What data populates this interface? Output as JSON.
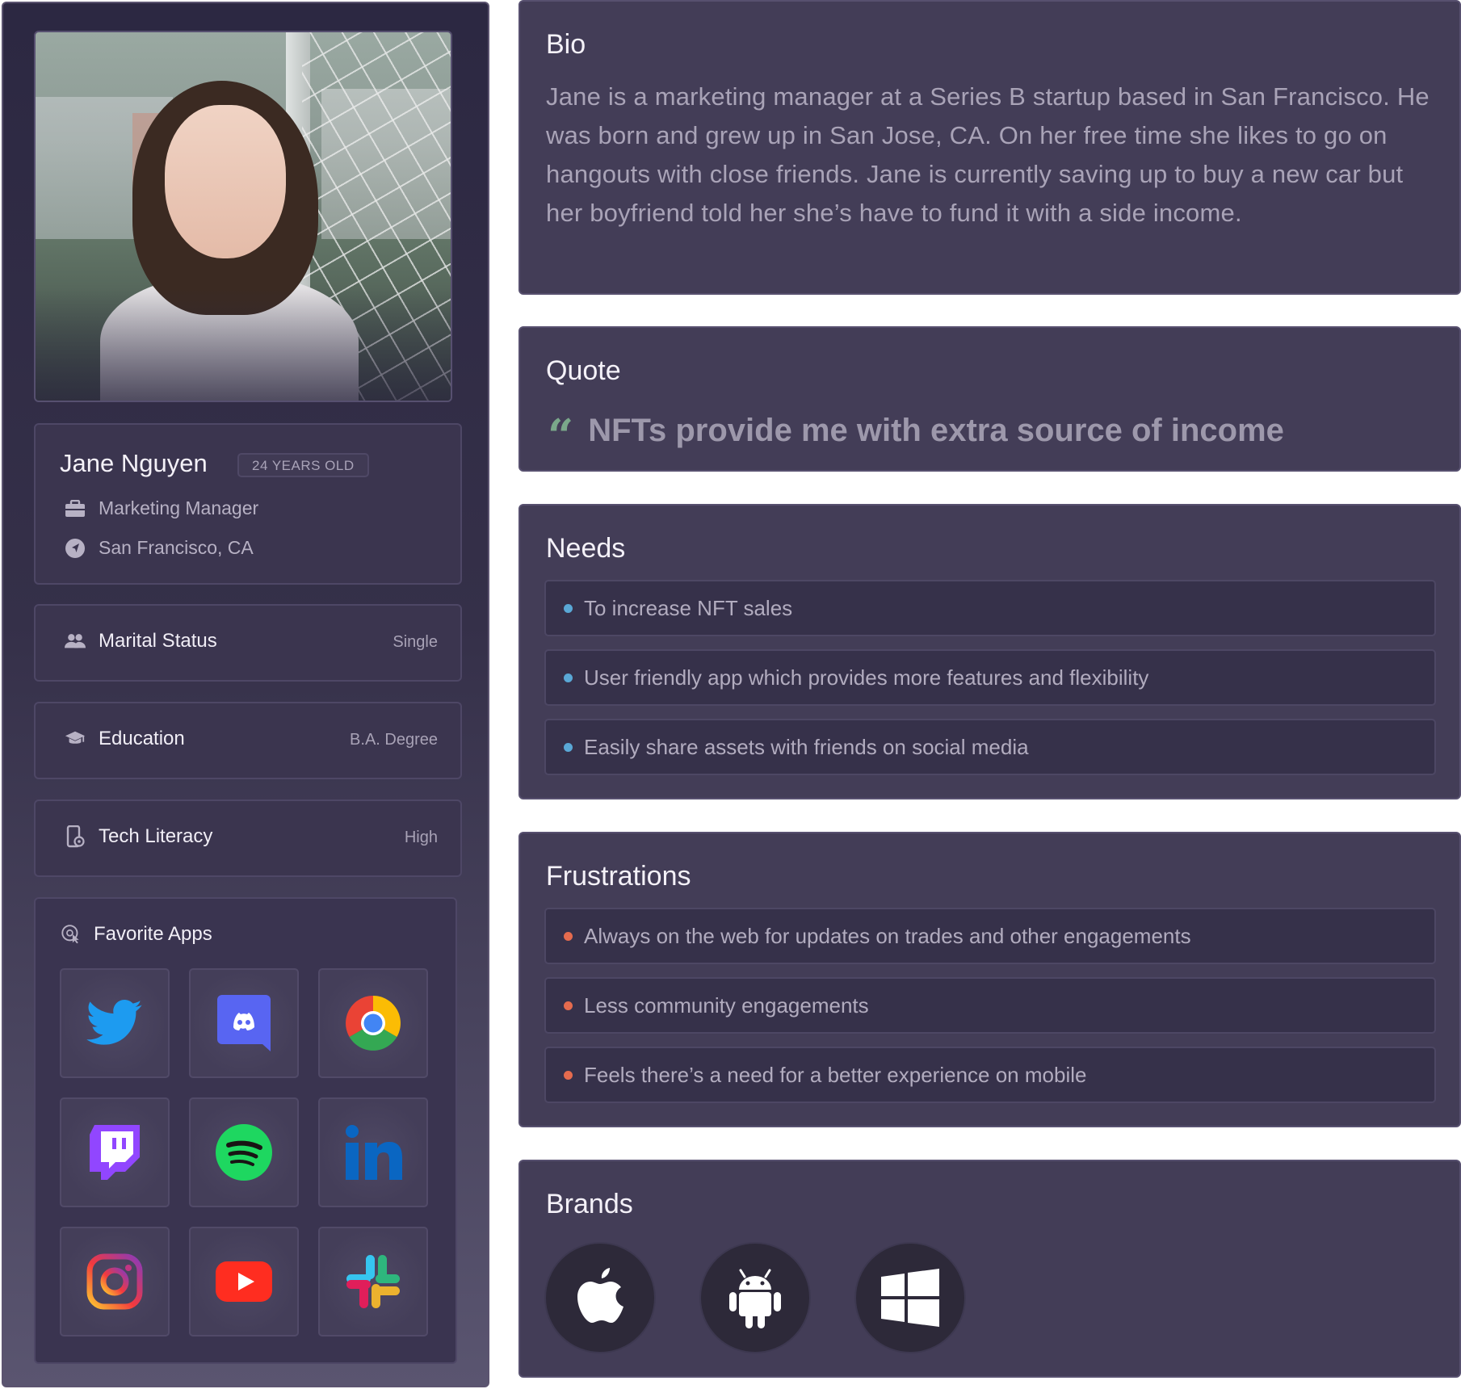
{
  "profile": {
    "name": "Jane Nguyen",
    "age_badge": "24 YEARS OLD",
    "job": "Marketing Manager",
    "location": "San Francisco, CA"
  },
  "attributes": [
    {
      "label": "Marital Status",
      "value": "Single",
      "icon": "people-icon"
    },
    {
      "label": "Education",
      "value": "B.A. Degree",
      "icon": "graduation-cap-icon"
    },
    {
      "label": "Tech Literacy",
      "value": "High",
      "icon": "phone-settings-icon"
    }
  ],
  "favorite_apps": {
    "title": "Favorite Apps",
    "apps": [
      "twitter-icon",
      "discord-icon",
      "chrome-icon",
      "twitch-icon",
      "spotify-icon",
      "linkedin-icon",
      "instagram-icon",
      "youtube-icon",
      "slack-icon"
    ]
  },
  "bio": {
    "title": "Bio",
    "text": "Jane is a marketing manager at a Series B startup based in San Francisco. He was born and grew up in San Jose, CA. On her free time she likes to go on hangouts with close friends. Jane is currently saving up to buy a new car but her boyfriend told her she’s have to fund it with a side income."
  },
  "quote": {
    "title": "Quote",
    "mark": "“",
    "text": "NFTs provide me with extra source of income"
  },
  "needs": {
    "title": "Needs",
    "items": [
      "To increase NFT sales",
      "User friendly app which provides more features and flexibility",
      "Easily share assets with friends on social media"
    ]
  },
  "frustrations": {
    "title": "Frustrations",
    "items": [
      "Always on the web for updates on trades and other engagements",
      "Less community engagements",
      "Feels there’s a need for a better experience on mobile"
    ]
  },
  "brands": {
    "title": "Brands",
    "items": [
      "apple-icon",
      "android-icon",
      "windows-icon"
    ]
  },
  "colors": {
    "needs_bullet": "#5aa8d6",
    "frustration_bullet": "#e56b4e",
    "quote_mark": "#7aa88a"
  }
}
